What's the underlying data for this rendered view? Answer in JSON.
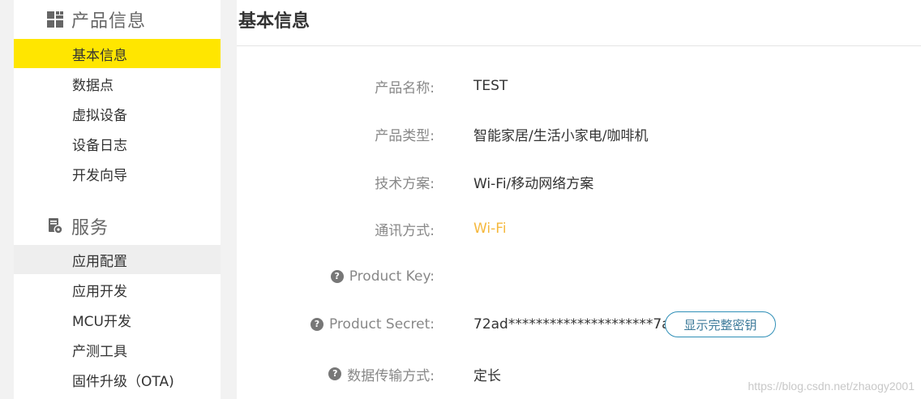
{
  "sidebar": {
    "sections": [
      {
        "title": "产品信息",
        "icon": "product-info-grid-icon",
        "items": [
          {
            "label": "基本信息",
            "state": "active"
          },
          {
            "label": "数据点"
          },
          {
            "label": "虚拟设备"
          },
          {
            "label": "设备日志"
          },
          {
            "label": "开发向导"
          }
        ]
      },
      {
        "title": "服务",
        "icon": "service-gear-document-icon",
        "items": [
          {
            "label": "应用配置",
            "state": "hover"
          },
          {
            "label": "应用开发"
          },
          {
            "label": "MCU开发"
          },
          {
            "label": "产测工具"
          },
          {
            "label": "固件升级（OTA)"
          }
        ]
      }
    ]
  },
  "main": {
    "title": "基本信息",
    "fields": [
      {
        "label": "产品名称:",
        "value": "TEST"
      },
      {
        "label": "产品类型:",
        "value": "智能家居/生活小家电/咖啡机"
      },
      {
        "label": "技术方案:",
        "value": "Wi-Fi/移动网络方案"
      },
      {
        "label": "通讯方式:",
        "value": "Wi-Fi"
      },
      {
        "label": "Product Key:",
        "value": "",
        "help_icon": "?"
      },
      {
        "label": "Product Secret:",
        "value": "72ad*********************7af7",
        "help_icon": "?"
      },
      {
        "label": "数据传输方式:",
        "value": "定长",
        "help_icon": "?"
      }
    ],
    "show_key_button": "显示完整密钥"
  },
  "watermark": "https://blog.csdn.net/zhaogy2001",
  "colors": {
    "active_nav": "#ffe600",
    "hover_nav": "#eeeeee",
    "accent_value": "#f5b83d",
    "button_border": "#2f8fb7"
  }
}
